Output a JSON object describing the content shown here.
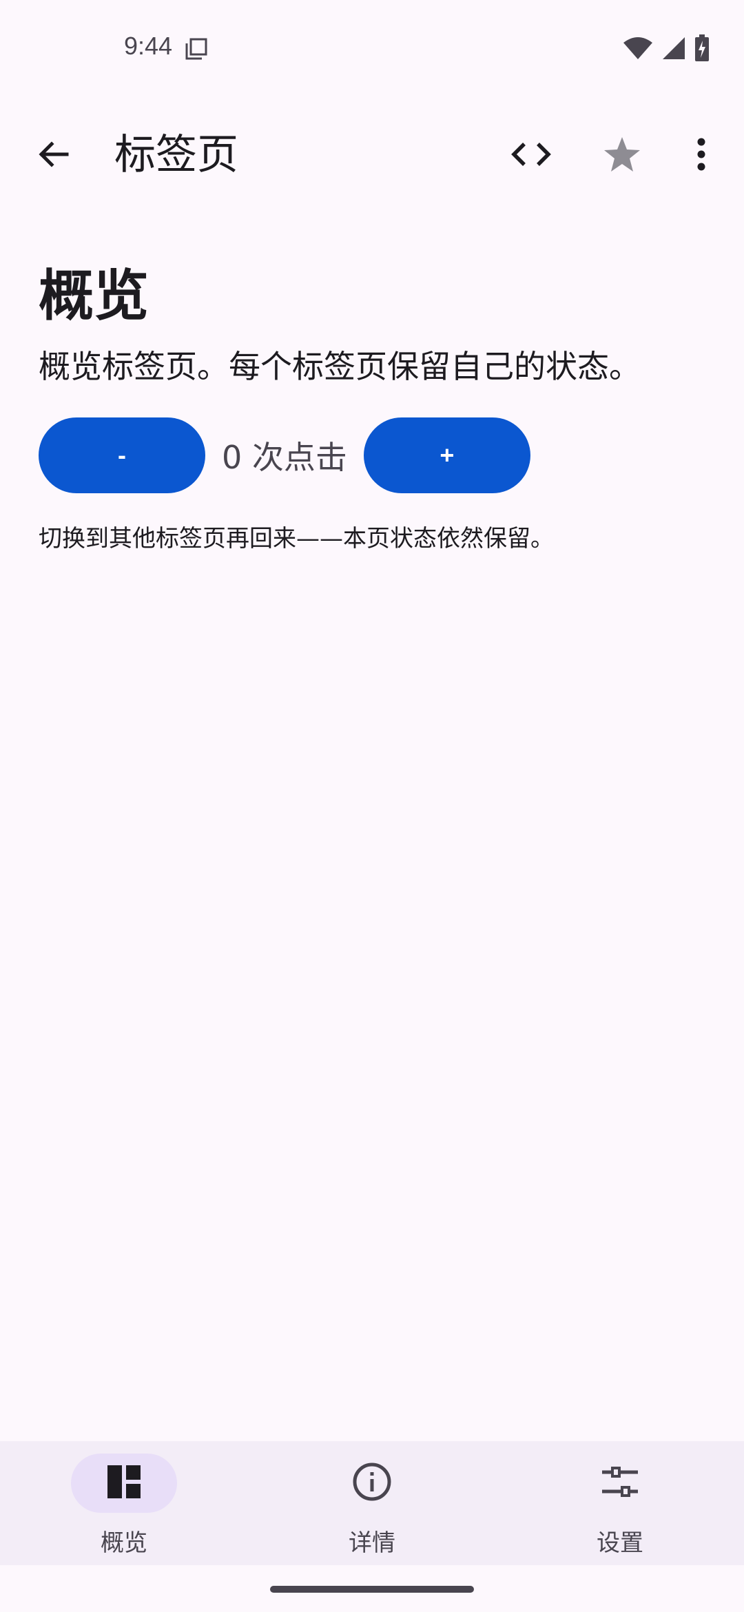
{
  "status_bar": {
    "time": "9:44"
  },
  "app_bar": {
    "title": "标签页"
  },
  "content": {
    "heading": "概览",
    "description": "概览标签页。每个标签页保留自己的状态。",
    "decrement_label": "-",
    "count_text": "0 次点击",
    "increment_label": "+",
    "hint": "切换到其他标签页再回来——本页状态依然保留。"
  },
  "bottom_nav": {
    "items": [
      {
        "label": "概览",
        "icon": "dashboard-icon",
        "active": true
      },
      {
        "label": "详情",
        "icon": "info-icon",
        "active": false
      },
      {
        "label": "设置",
        "icon": "tune-icon",
        "active": false
      }
    ]
  },
  "colors": {
    "background": "#fdf8fd",
    "accent": "#0b57d0",
    "nav_background": "#f3edf7",
    "nav_indicator": "#e8def8"
  }
}
